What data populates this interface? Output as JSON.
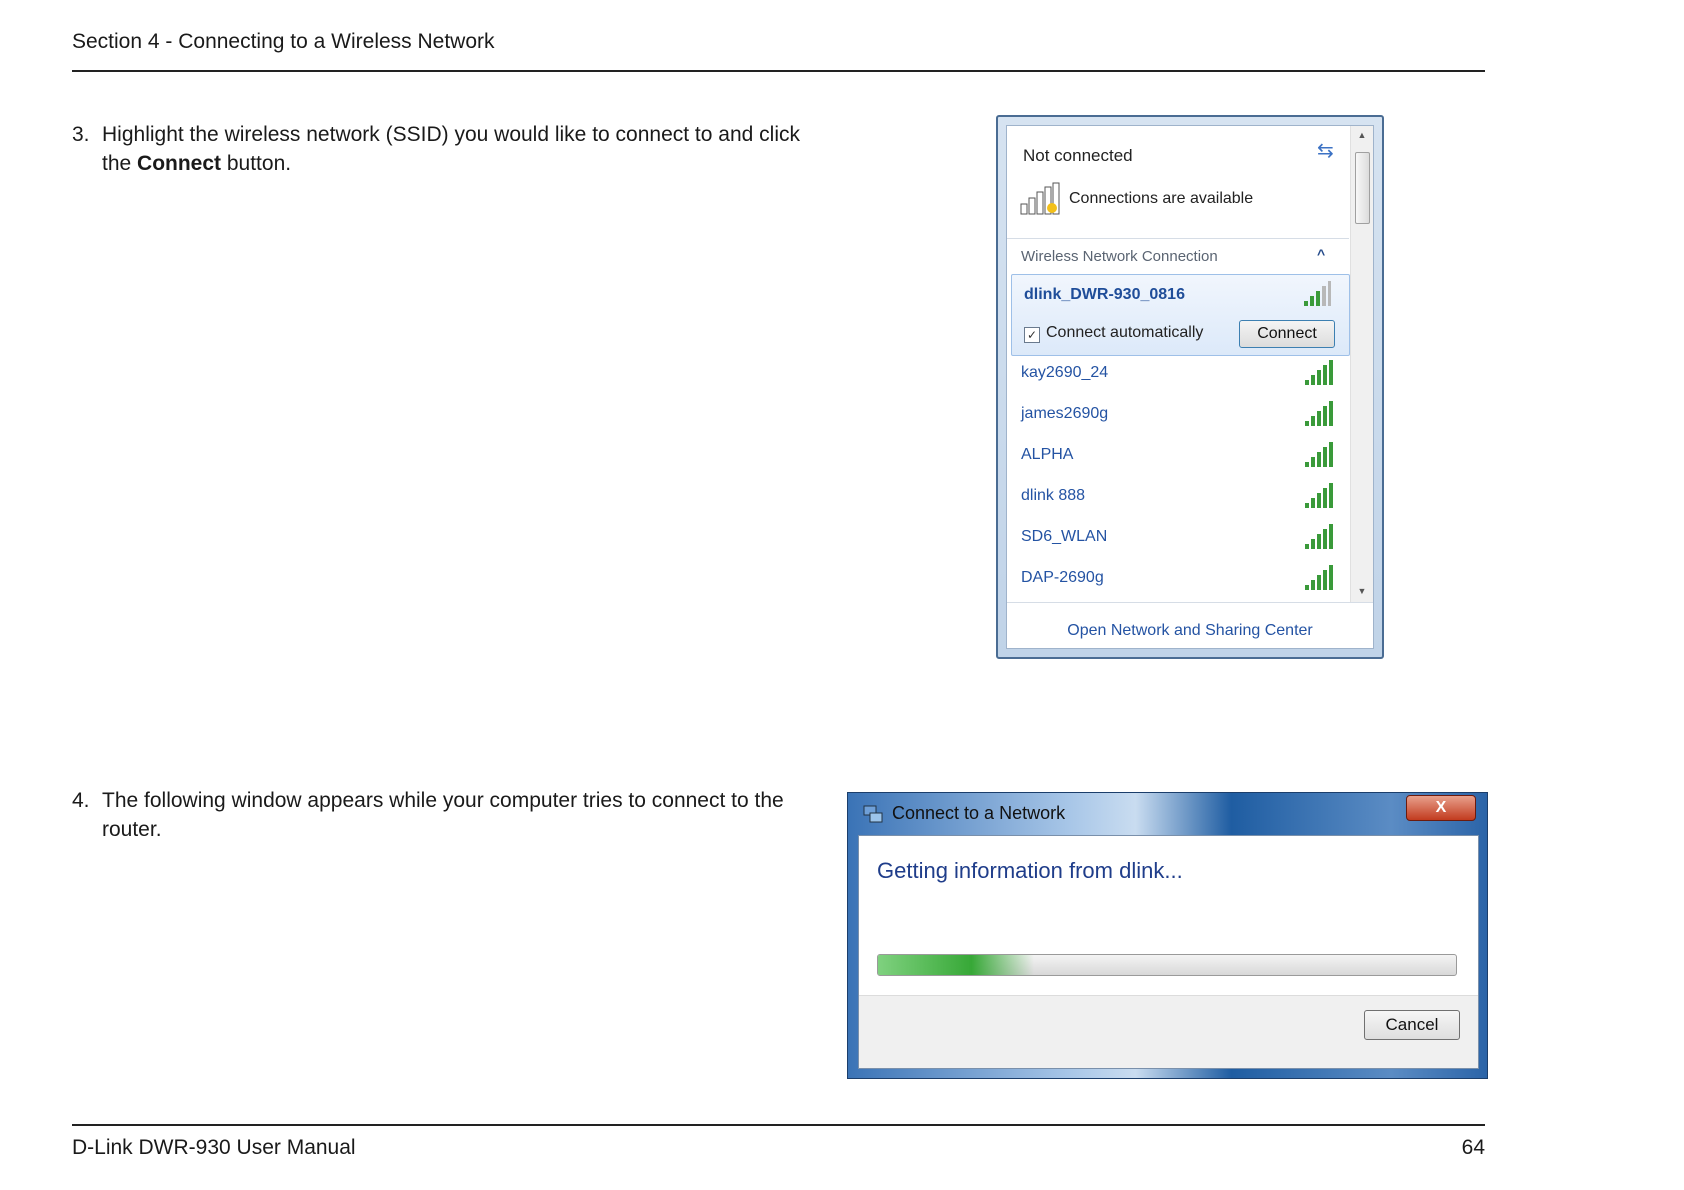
{
  "header": {
    "section": "Section 4 - Connecting to a Wireless Network"
  },
  "steps": [
    {
      "num": "3.",
      "text_before": "Highlight the wireless network (SSID) you would like to connect to and click the ",
      "bold": "Connect",
      "text_after": " button."
    },
    {
      "num": "4.",
      "text": "The following window appears while your computer tries to connect to the router."
    }
  ],
  "wifi_popup": {
    "status": "Not connected",
    "availability": "Connections are available",
    "section_label": "Wireless Network Connection",
    "selected_network": "dlink_DWR-930_0816",
    "connect_automatically_label": "Connect automatically",
    "connect_automatically_checked": true,
    "connect_button": "Connect",
    "networks": [
      "kay2690_24",
      "james2690g",
      "ALPHA",
      "dlink 888",
      "SD6_WLAN",
      "DAP-2690g"
    ],
    "footer_link": "Open Network and Sharing Center",
    "icons": {
      "refresh": "refresh-icon",
      "collapse": "chevron-up-icon",
      "signal": "signal-bars-icon"
    },
    "colors": {
      "link": "#2453a3",
      "selected_bg": "#dce9f9",
      "signal": "#3a9a3a"
    }
  },
  "connect_dialog": {
    "title": "Connect to a Network",
    "close_label": "X",
    "message": "Getting information from dlink...",
    "progress": 0.27,
    "cancel_button": "Cancel"
  },
  "footer": {
    "manual": "D-Link DWR-930 User Manual",
    "page": "64"
  }
}
